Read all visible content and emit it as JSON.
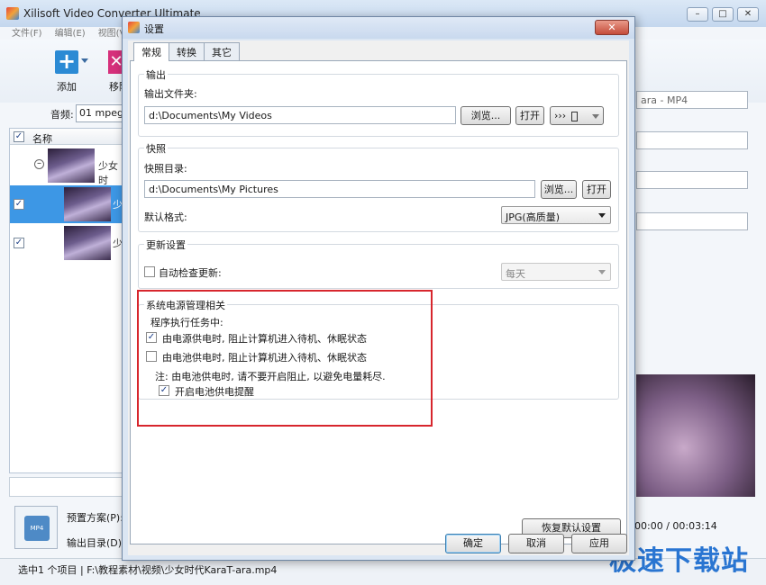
{
  "main": {
    "title": "Xilisoft Video Converter Ultimate",
    "window_buttons": [
      "–",
      "□",
      "✕"
    ],
    "menu": [
      "文件(F)",
      "编辑(E)",
      "视图(V)"
    ],
    "toolbar": {
      "add_label": "添加",
      "remove_label": "移除"
    },
    "audio_label": "音频:",
    "audio_value": "01 mpeg4",
    "list_header": "名称",
    "rows": [
      {
        "checked": "",
        "text": "少女时"
      },
      {
        "checked": "✓",
        "text": "少"
      },
      {
        "checked": "✓",
        "text": "少"
      }
    ],
    "preset_label": "预置方案(P):",
    "output_label": "输出目录(D):",
    "preset_icon": "MP4",
    "right_format": "ara - MP4",
    "preview_time": "00:00 / 00:03:14",
    "status": "选中1 个项目 | F:\\教程素材\\视频\\少女时代KaraT-ara.mp4",
    "watermark": "极速下载站"
  },
  "dialog": {
    "title": "设置",
    "close": "✕",
    "tabs": [
      "常规",
      "转换",
      "其它"
    ],
    "output": {
      "group": "输出",
      "folder_label": "输出文件夹:",
      "folder_value": "d:\\Documents\\My Videos",
      "browse": "浏览...",
      "open": "打开",
      "extra": "›››"
    },
    "snapshot": {
      "group": "快照",
      "dir_label": "快照目录:",
      "dir_value": "d:\\Documents\\My Pictures",
      "browse": "浏览...",
      "open": "打开",
      "format_label": "默认格式:",
      "format_value": "JPG(高质量)"
    },
    "update": {
      "group": "更新设置",
      "auto_label": "自动检查更新:",
      "frequency": "每天"
    },
    "power": {
      "group": "系统电源管理相关",
      "subtitle": "程序执行任务中:",
      "opt1": "由电源供电时, 阻止计算机进入待机、休眠状态",
      "opt2": "由电池供电时, 阻止计算机进入待机、休眠状态",
      "note": "注: 由电池供电时, 请不要开启阻止, 以避免电量耗尽.",
      "opt3": "开启电池供电提醒"
    },
    "restore_defaults": "恢复默认设置",
    "ok": "确定",
    "cancel": "取消",
    "apply": "应用"
  },
  "colors": {
    "highlight": "#d7262d",
    "selection": "#3d97e5",
    "brand_blue": "#1f6fd0"
  }
}
